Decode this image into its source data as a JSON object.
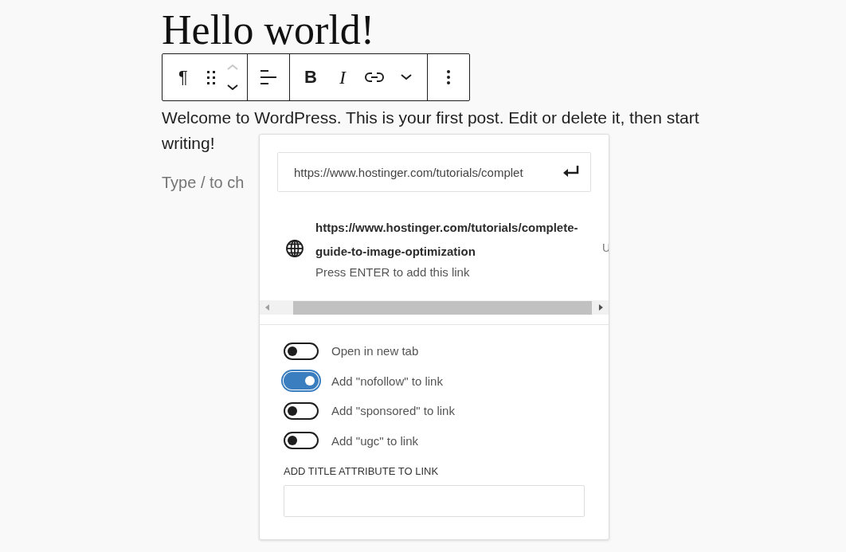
{
  "post": {
    "title": "Hello world!",
    "paragraph": "Welcome to WordPress. This is your first post. Edit or delete it, then start writing!",
    "placeholder": "Type / to ch"
  },
  "toolbar": {
    "groups": [
      {
        "buttons": [
          {
            "kind": "paragraph",
            "label": "¶"
          },
          {
            "kind": "drag"
          },
          {
            "kind": "mover",
            "up_disabled": true
          }
        ]
      },
      {
        "buttons": [
          {
            "kind": "align"
          }
        ]
      },
      {
        "buttons": [
          {
            "kind": "bold",
            "label": "B"
          },
          {
            "kind": "italic",
            "label": "I"
          },
          {
            "kind": "link"
          },
          {
            "kind": "more"
          }
        ]
      },
      {
        "buttons": [
          {
            "kind": "options"
          }
        ]
      }
    ]
  },
  "link_popover": {
    "url_value": "https://www.hostinger.com/tutorials/complet",
    "suggestion": {
      "title": "https://www.hostinger.com/tutorials/complete-guide-to-image-optimization",
      "hint": "Press ENTER to add this link",
      "type": "U"
    },
    "toggles": [
      {
        "label": "Open in new tab",
        "on": false
      },
      {
        "label": "Add \"nofollow\" to link",
        "on": true
      },
      {
        "label": "Add \"sponsored\" to link",
        "on": false
      },
      {
        "label": "Add \"ugc\" to link",
        "on": false
      }
    ],
    "title_attribute": {
      "label": "ADD TITLE ATTRIBUTE TO LINK"
    }
  }
}
